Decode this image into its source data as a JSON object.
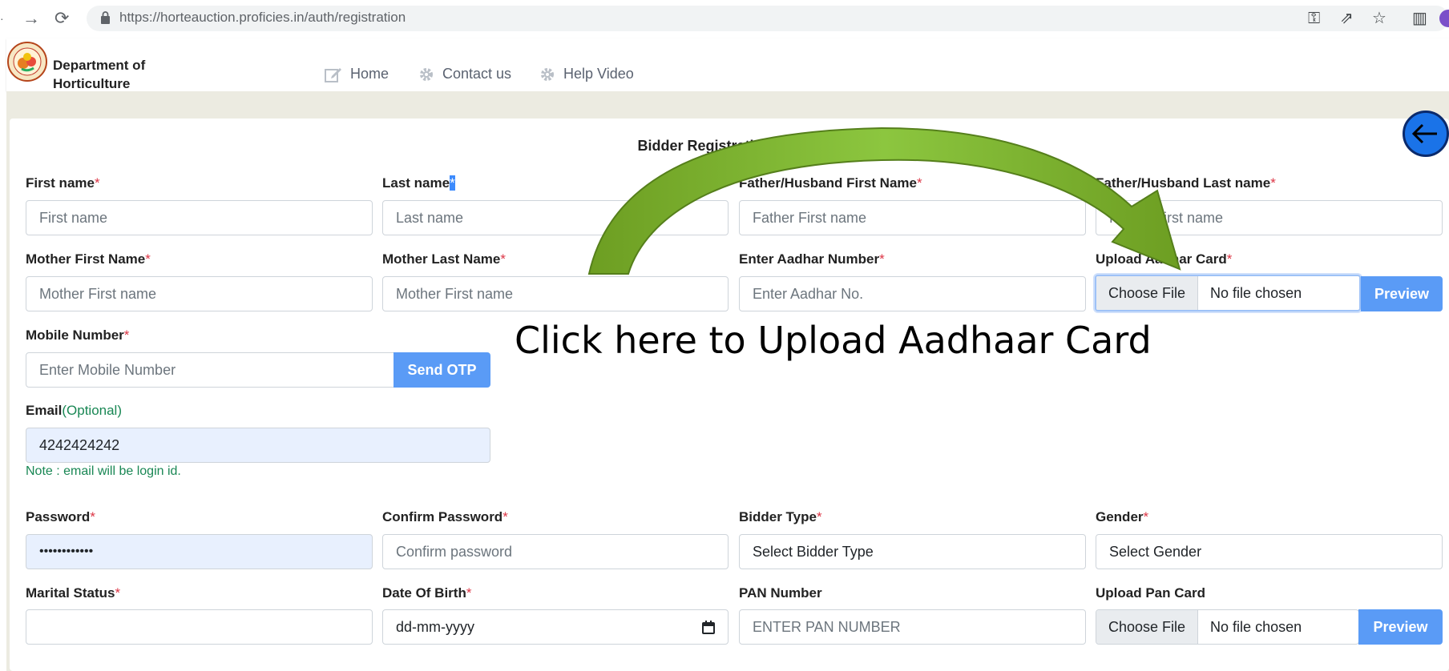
{
  "browser": {
    "url": "https://horteauction.proficies.in/auth/registration"
  },
  "header": {
    "org_line1": "Department of",
    "org_line2": "Horticulture",
    "menu": [
      {
        "label": "Home",
        "icon": "edit-icon"
      },
      {
        "label": "Contact us",
        "icon": "gear-icon"
      },
      {
        "label": "Help Video",
        "icon": "gear-icon"
      }
    ]
  },
  "form": {
    "title": "Bidder Registration Form",
    "first_name": {
      "label": "First name",
      "required": "*",
      "placeholder": "First name"
    },
    "last_name": {
      "label": "Last name",
      "required": "*",
      "placeholder": "Last name"
    },
    "father_first": {
      "label": "Father/Husband First Name",
      "required": "*",
      "placeholder": "Father First name"
    },
    "father_last": {
      "label": "Father/Husband Last name",
      "required": "*",
      "placeholder": "Father First name"
    },
    "mother_first": {
      "label": "Mother First Name",
      "required": "*",
      "placeholder": "Mother First name"
    },
    "mother_last": {
      "label": "Mother Last Name",
      "required": "*",
      "placeholder": "Mother First name"
    },
    "aadhar": {
      "label": "Enter Aadhar Number",
      "required": "*",
      "placeholder": "Enter Aadhar No."
    },
    "aadhar_upload": {
      "label": "Upload Aadhar Card",
      "required": "*",
      "choose": "Choose File",
      "status": "No file chosen",
      "preview": "Preview"
    },
    "mobile": {
      "label": "Mobile Number",
      "required": "*",
      "placeholder": "Enter Mobile Number",
      "button": "Send OTP"
    },
    "email": {
      "label": "Email",
      "optional": "(Optional)",
      "value": "4242424242",
      "note": "Note : email will be login id."
    },
    "password": {
      "label": "Password",
      "required": "*",
      "value": "••••••••••••"
    },
    "confirm_password": {
      "label": "Confirm Password",
      "required": "*",
      "placeholder": "Confirm password"
    },
    "bidder_type": {
      "label": "Bidder Type",
      "required": "*",
      "value": "Select Bidder Type"
    },
    "gender": {
      "label": "Gender",
      "required": "*",
      "value": "Select Gender"
    },
    "marital": {
      "label": "Marital Status",
      "required": "*",
      "value": ""
    },
    "dob": {
      "label": "Date Of Birth",
      "required": "*",
      "placeholder": "dd-mm-yyyy"
    },
    "pan": {
      "label": "PAN Number",
      "placeholder": "ENTER PAN NUMBER"
    },
    "pan_upload": {
      "label": "Upload Pan Card",
      "choose": "Choose File",
      "status": "No file chosen",
      "preview": "Preview"
    }
  },
  "annotation": {
    "text": "Click here to Upload Aadhaar Card",
    "arrow_color": "#7cb32a"
  },
  "colors": {
    "primary_button": "#5a9bf6",
    "required": "#dc3545",
    "note": "#198754",
    "page_band": "#ecebe1"
  }
}
